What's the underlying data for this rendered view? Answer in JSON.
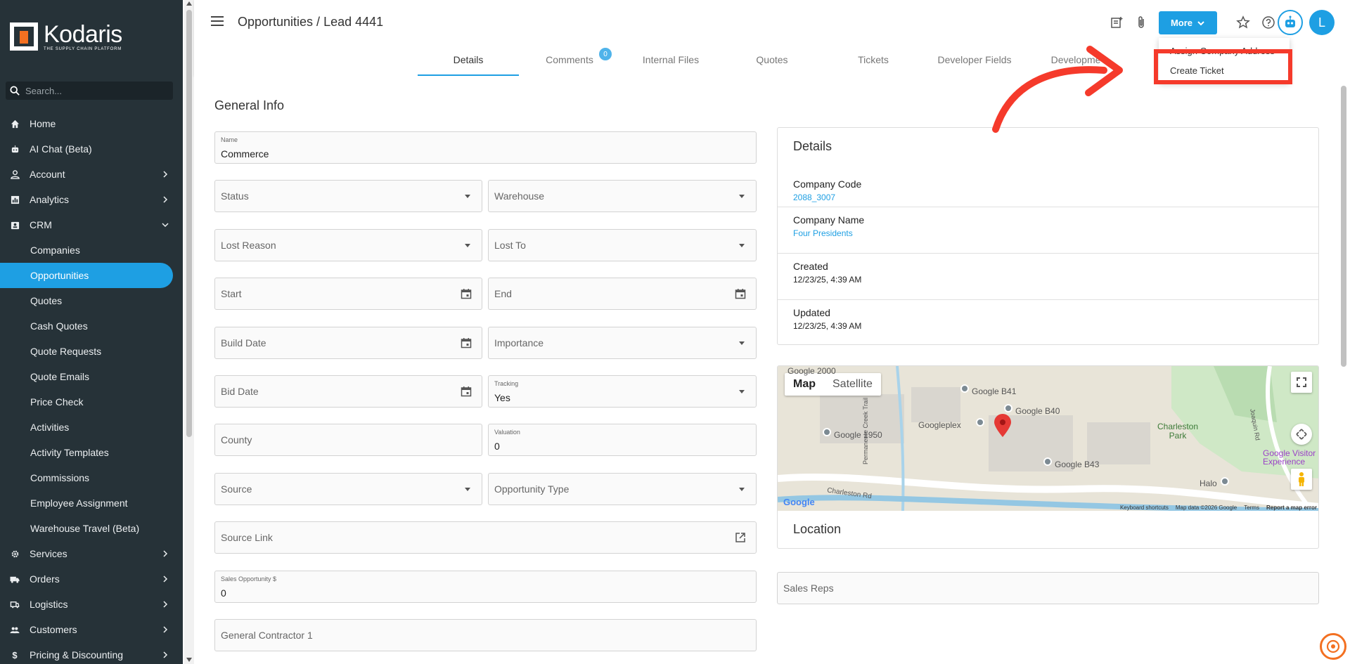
{
  "app": {
    "logo_name": "Kodaris",
    "logo_tagline": "THE SUPPLY CHAIN PLATFORM"
  },
  "search": {
    "placeholder": "Search..."
  },
  "sidebar": {
    "items": [
      {
        "label": "Home",
        "icon": "home-icon"
      },
      {
        "label": "AI Chat (Beta)",
        "icon": "robot-icon"
      },
      {
        "label": "Account",
        "icon": "person-icon"
      },
      {
        "label": "Analytics",
        "icon": "chart-icon"
      },
      {
        "label": "CRM",
        "icon": "contacts-icon"
      }
    ],
    "crm_sub": [
      "Companies",
      "Opportunities",
      "Quotes",
      "Cash Quotes",
      "Quote Requests",
      "Quote Emails",
      "Price Check",
      "Activities",
      "Activity Templates",
      "Commissions",
      "Employee Assignment",
      "Warehouse Travel (Beta)"
    ],
    "bottom_items": [
      {
        "label": "Services",
        "icon": "gear-icon"
      },
      {
        "label": "Orders",
        "icon": "truck-icon"
      },
      {
        "label": "Logistics",
        "icon": "shipping-icon"
      },
      {
        "label": "Customers",
        "icon": "people-icon"
      },
      {
        "label": "Pricing & Discounting",
        "icon": "dollar-icon"
      }
    ]
  },
  "header": {
    "title": "Opportunities / Lead 4441",
    "more_label": "More",
    "avatar_initial": "L"
  },
  "tabs": [
    {
      "label": "Details"
    },
    {
      "label": "Comments",
      "badge": "0"
    },
    {
      "label": "Internal Files"
    },
    {
      "label": "Quotes"
    },
    {
      "label": "Tickets"
    },
    {
      "label": "Developer Fields"
    },
    {
      "label": "Developme"
    }
  ],
  "menu": {
    "items": [
      "Assign Company Address",
      "Create Ticket"
    ]
  },
  "form": {
    "section_title": "General Info",
    "name_label": "Name",
    "name_value": "Commerce",
    "status": "Status",
    "warehouse": "Warehouse",
    "lost_reason": "Lost Reason",
    "lost_to": "Lost To",
    "start": "Start",
    "end": "End",
    "build_date": "Build Date",
    "importance": "Importance",
    "bid_date": "Bid Date",
    "tracking_label": "Tracking",
    "tracking_value": "Yes",
    "county": "County",
    "valuation_label": "Valuation",
    "valuation_value": "0",
    "source": "Source",
    "opportunity_type": "Opportunity Type",
    "source_link": "Source Link",
    "sales_opp_label": "Sales Opportunity $",
    "sales_opp_value": "0",
    "general_contractor": "General Contractor 1"
  },
  "details": {
    "title": "Details",
    "rows": [
      {
        "key": "Company Code",
        "value": "2088_3007"
      },
      {
        "key": "Company Name",
        "value": "Four Presidents"
      },
      {
        "key": "Created",
        "value": "12/23/25, 4:39 AM"
      },
      {
        "key": "Updated",
        "value": "12/23/25, 4:39 AM"
      }
    ]
  },
  "map": {
    "tab_map": "Map",
    "tab_satellite": "Satellite",
    "labels": [
      "Google 2000",
      "Google B41",
      "Google B40",
      "Googleplex",
      "Google 1950",
      "Google B43",
      "Charleston Park",
      "Google Visitor Experience",
      "Halo",
      "Permanente Creek Trail",
      "Joaquin Rd",
      "Charleston Rd"
    ],
    "footer": [
      "Keyboard shortcuts",
      "Map data ©2026 Google",
      "Terms",
      "Report a map error"
    ],
    "google_logo": "Google",
    "location_title": "Location"
  },
  "sales_reps": "Sales Reps",
  "colors": {
    "accent": "#1e9fe3",
    "sidebar": "#263238",
    "highlight": "#f53a2b",
    "brand_orange": "#f37021"
  }
}
